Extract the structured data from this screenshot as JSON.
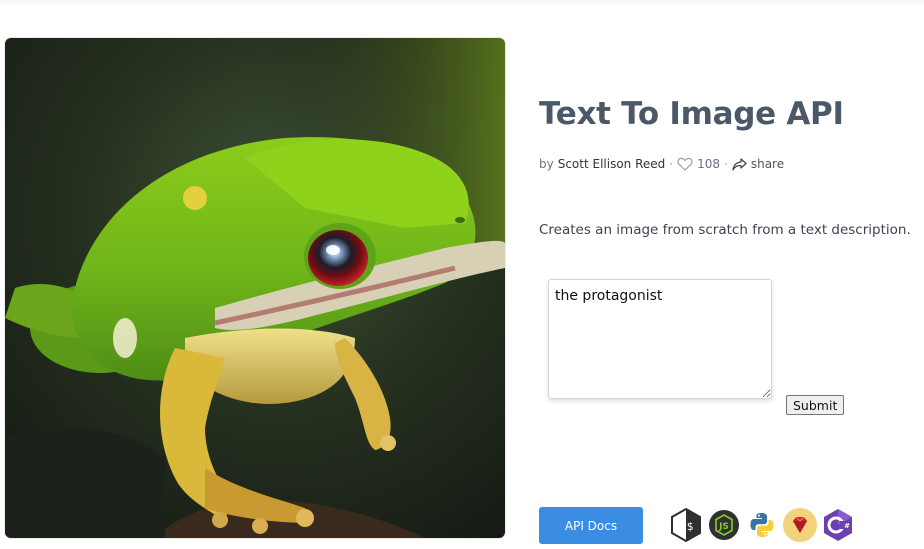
{
  "page": {
    "title": "Text To Image API",
    "author_prefix": "by",
    "author": "Scott Ellison Reed",
    "likes": "108",
    "share_label": "share",
    "description": "Creates an image from scratch from a text description."
  },
  "form": {
    "prompt_value": "the protagonist",
    "submit_label": "Submit"
  },
  "footer": {
    "docs_label": "API Docs",
    "languages": [
      "shell-icon",
      "nodejs-icon",
      "python-icon",
      "ruby-icon",
      "csharp-icon"
    ]
  },
  "colors": {
    "title": "#4b5867",
    "accent": "#3b8de3"
  },
  "image": {
    "subject": "green-frog-image"
  }
}
